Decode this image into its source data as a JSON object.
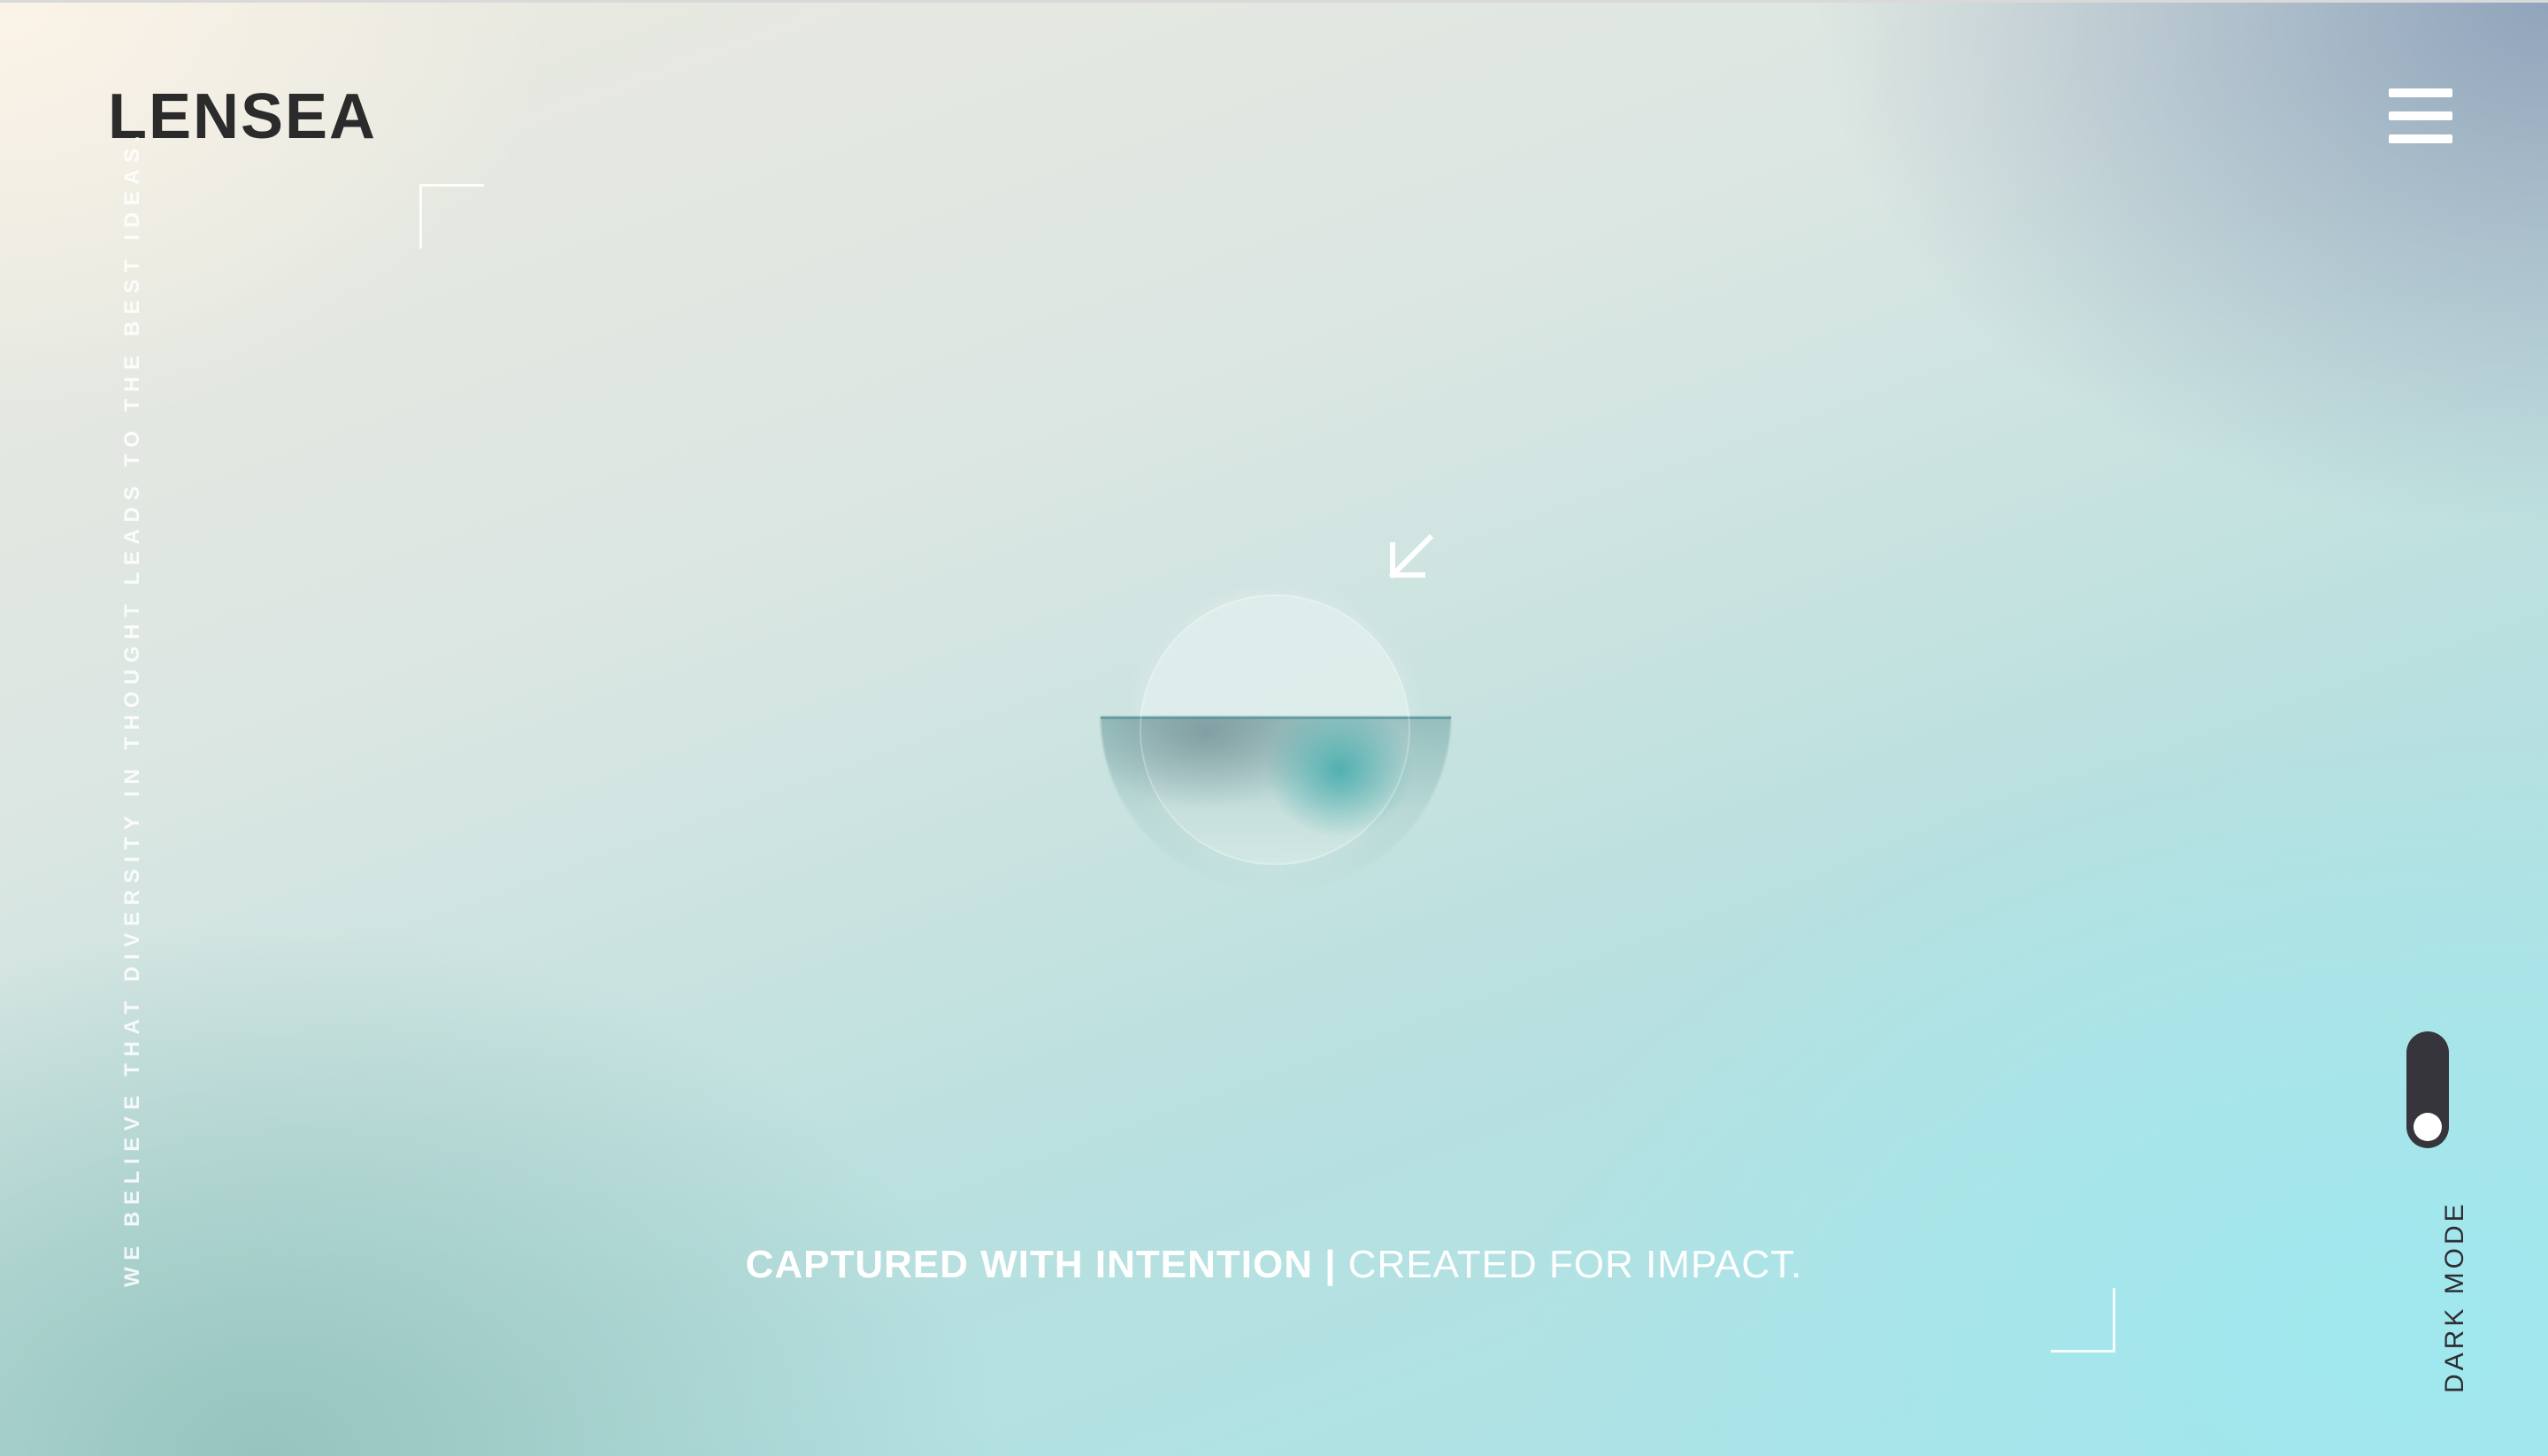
{
  "brand": {
    "logo_text": "LENSEA"
  },
  "header": {
    "menu_icon": "hamburger-menu-icon"
  },
  "side": {
    "vertical_tagline": "WE BELIEVE THAT DIVERSITY IN THOUGHT LEADS TO THE BEST IDEAS."
  },
  "hero": {
    "arrow_icon": "arrow-down-left-icon",
    "tagline_strong": "CAPTURED WITH INTENTION |",
    "tagline_light": " CREATED FOR IMPACT."
  },
  "theme_toggle": {
    "label": "DARK MODE",
    "enabled": false
  },
  "colors": {
    "logo": "#2b2b2b",
    "toggle_track": "#35353b",
    "white": "#ffffff"
  }
}
